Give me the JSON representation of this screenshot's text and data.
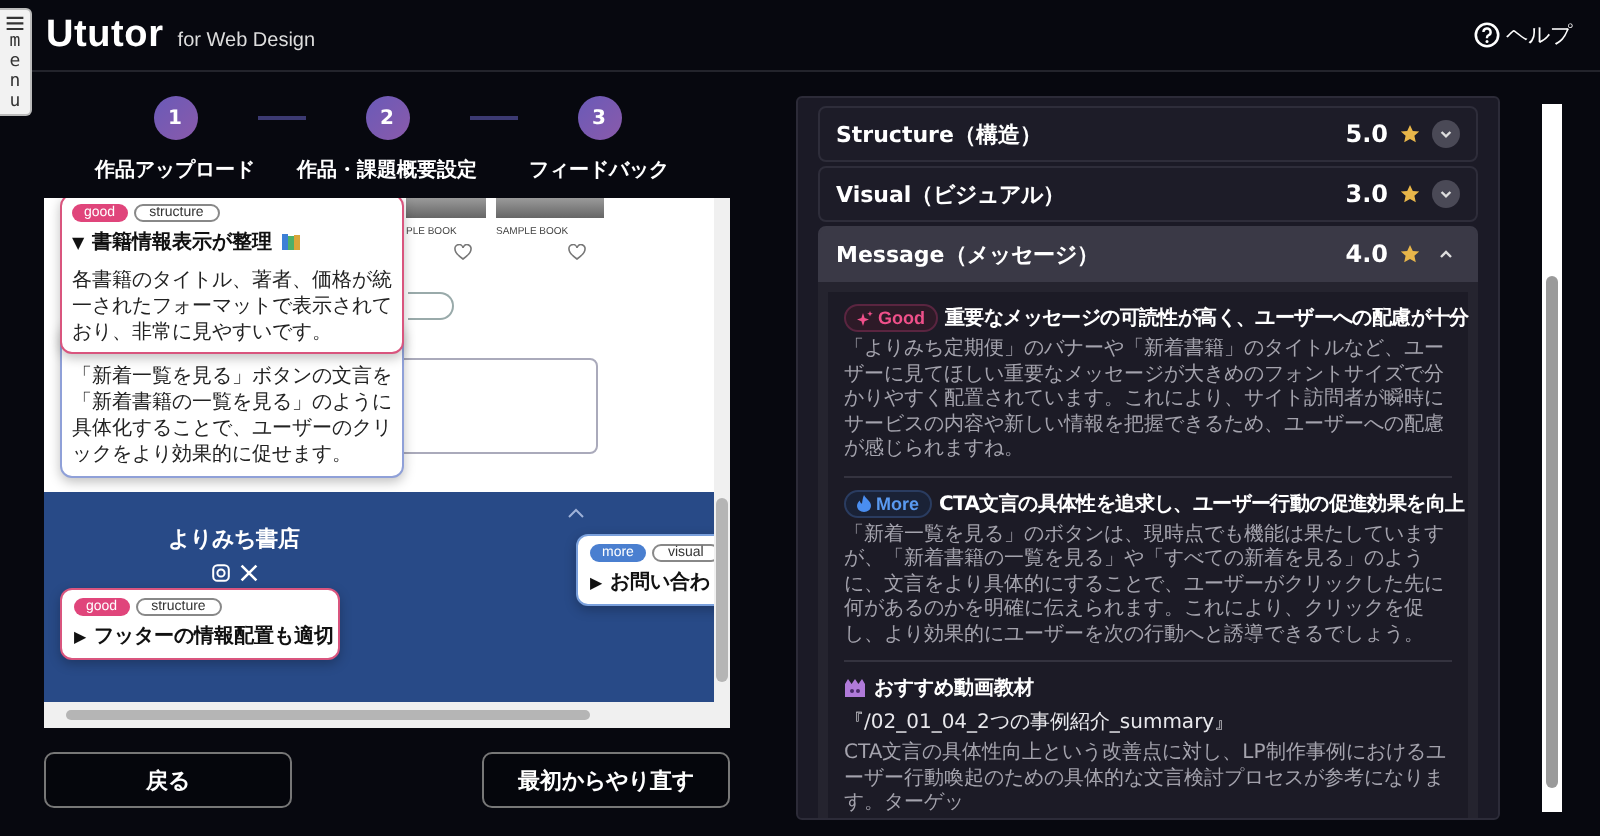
{
  "header": {
    "logo": "Ututor",
    "subtitle": "for Web Design",
    "menu_label": "menu",
    "help": "ヘルプ"
  },
  "steps": [
    {
      "number": "1",
      "label": "作品アップロード"
    },
    {
      "number": "2",
      "label": "作品・課題概要設定"
    },
    {
      "number": "3",
      "label": "フィードバック"
    }
  ],
  "preview": {
    "books": [
      {
        "title": "PLE BOOK"
      },
      {
        "title": "SAMPLE BOOK"
      }
    ],
    "footer_logo": "よりみち書店",
    "cards": [
      {
        "kind": "good",
        "tag": "good",
        "category": "structure",
        "toggle": "▼",
        "title": "書籍情報表示が整理",
        "body": "各書籍のタイトル、著者、価格が統一されたフォーマットで表示されており、非常に見やすいです。"
      },
      {
        "kind": "plain",
        "body": "「新着一覧を見る」ボタンの文言を「新着書籍の一覧を見る」のように具体化することで、ユーザーのクリックをより効果的に促せます。"
      },
      {
        "kind": "good",
        "tag": "good",
        "category": "structure",
        "toggle": "▶",
        "title": "フッターの情報配置も適切"
      },
      {
        "kind": "more",
        "tag": "more",
        "category": "visual",
        "toggle": "▶",
        "title": "お問い合わ"
      }
    ]
  },
  "buttons": [
    {
      "kind": "back",
      "label": "戻る"
    },
    {
      "kind": "restart",
      "label": "最初からやり直す"
    }
  ],
  "criteria": [
    {
      "label": "Structure（構造）",
      "score": "5.0",
      "expanded": false
    },
    {
      "label": "Visual（ビジュアル）",
      "score": "3.0",
      "expanded": false
    },
    {
      "label": "Message（メッセージ）",
      "score": "4.0",
      "expanded": true
    }
  ],
  "feedback": [
    {
      "kind": "good",
      "tag": "Good",
      "title": "重要なメッセージの可読性が高く、ユーザーへの配慮が十分",
      "body": "「よりみち定期便」のバナーや「新着書籍」のタイトルなど、ユーザーに見てほしい重要なメッセージが大きめのフォントサイズで分かりやすく配置されています。これにより、サイト訪問者が瞬時にサービスの内容や新しい情報を把握できるため、ユーザーへの配慮が感じられますね。"
    },
    {
      "kind": "more",
      "tag": "More",
      "title": "CTA文言の具体性を追求し、ユーザー行動の促進効果を向上",
      "body": "「新着一覧を見る」のボタンは、現時点でも機能は果たしていますが、「新着書籍の一覧を見る」や「すべての新着を見る」のように、文言をより具体的にすることで、ユーザーがクリックした先に何があるのかを明確に伝えられます。これにより、クリックを促し、より効果的にユーザーを次の行動へと誘導できるでしょう。"
    }
  ],
  "recommended": {
    "heading": "おすすめ動画教材",
    "file": "『/02_01_04_2つの事例紹介_summary』",
    "description": "CTA文言の具体性向上という改善点に対し、LP制作事例におけるユーザー行動喚起のための具体的な文言検討プロセスが参考になります。ターゲッ"
  }
}
